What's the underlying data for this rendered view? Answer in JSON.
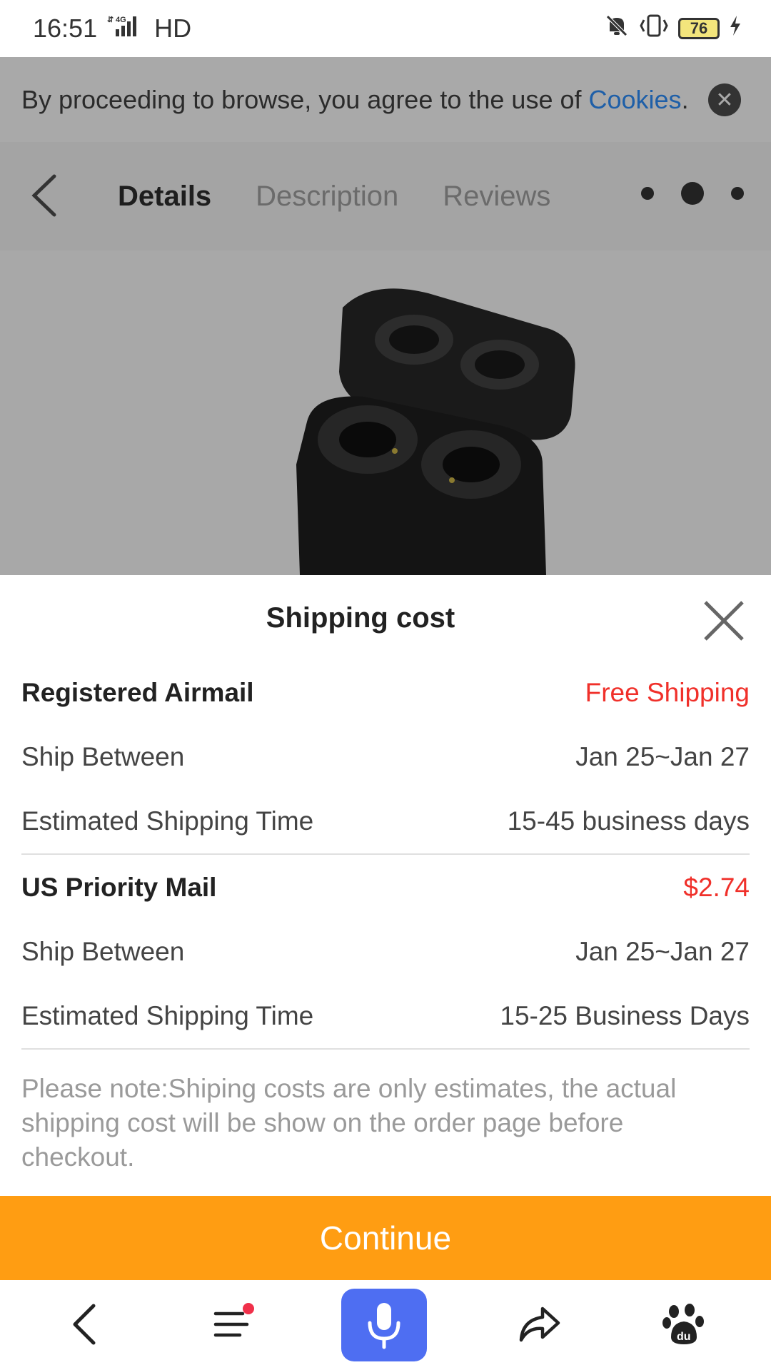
{
  "status_bar": {
    "time": "16:51",
    "network": "4G",
    "hd": "HD",
    "battery": "76",
    "icons": [
      "signal-icon",
      "mute-icon",
      "vibrate-icon",
      "battery-icon",
      "charging-icon"
    ]
  },
  "cookie_banner": {
    "text": "By proceeding to browse, you agree to the use of ",
    "link": "Cookies",
    "suffix": "."
  },
  "header": {
    "tabs": [
      {
        "label": "Details",
        "active": true
      },
      {
        "label": "Description",
        "active": false
      },
      {
        "label": "Reviews",
        "active": false
      }
    ]
  },
  "sheet": {
    "title": "Shipping cost",
    "methods": [
      {
        "name": "Registered Airmail",
        "price": "Free Shipping",
        "ship_between_label": "Ship Between",
        "ship_between_value": "Jan 25~Jan 27",
        "est_label": "Estimated Shipping Time",
        "est_value": "15-45 business days"
      },
      {
        "name": "US Priority Mail",
        "price": "$2.74",
        "ship_between_label": "Ship Between",
        "ship_between_value": "Jan 25~Jan 27",
        "est_label": "Estimated Shipping Time",
        "est_value": "15-25 Business Days"
      }
    ],
    "note": "Please note:Shiping costs are only estimates, the actual shipping cost will be show on the order page before checkout.",
    "continue_label": "Continue"
  },
  "colors": {
    "accent": "#ff9d12",
    "price_red": "#f0302a",
    "link_blue": "#1e5fa8",
    "mic_blue": "#4e6ef2"
  }
}
